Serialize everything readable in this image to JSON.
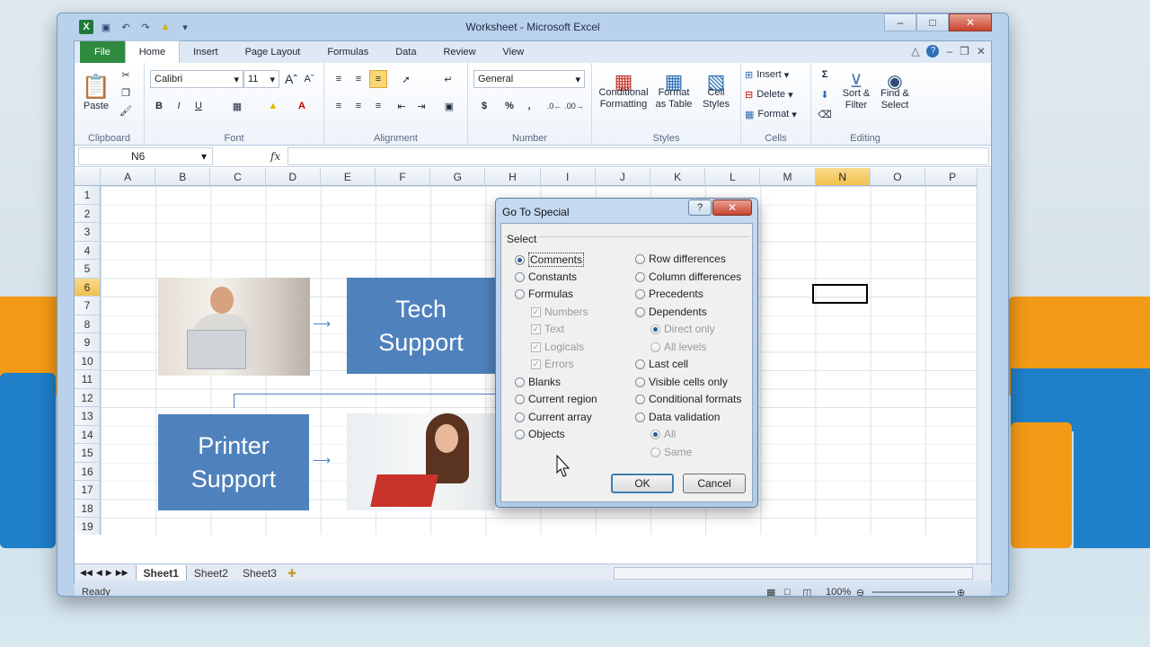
{
  "window": {
    "title": "Worksheet - Microsoft Excel"
  },
  "tabs": [
    "File",
    "Home",
    "Insert",
    "Page Layout",
    "Formulas",
    "Data",
    "Review",
    "View"
  ],
  "ribbon": {
    "clipboard": {
      "label": "Clipboard",
      "paste": "Paste"
    },
    "font": {
      "label": "Font",
      "name": "Calibri",
      "size": "11",
      "bold": "B",
      "italic": "I",
      "underline": "U"
    },
    "alignment": {
      "label": "Alignment"
    },
    "number": {
      "label": "Number",
      "format": "General",
      "currency": "$",
      "percent": "%",
      "comma": ","
    },
    "styles": {
      "label": "Styles",
      "conditional": "Conditional Formatting",
      "format_table": "Format as Table",
      "cell_styles": "Cell Styles"
    },
    "cells": {
      "label": "Cells",
      "insert": "Insert",
      "delete": "Delete",
      "format": "Format"
    },
    "editing": {
      "label": "Editing",
      "sort": "Sort & Filter",
      "find": "Find & Select"
    }
  },
  "formula_bar": {
    "name_box": "N6",
    "fx": "fx"
  },
  "columns": [
    "A",
    "B",
    "C",
    "D",
    "E",
    "F",
    "G",
    "H",
    "I",
    "J",
    "K",
    "L",
    "M",
    "N",
    "O",
    "P"
  ],
  "selected_column": "N",
  "rows": [
    "1",
    "2",
    "3",
    "4",
    "5",
    "6",
    "7",
    "8",
    "9",
    "10",
    "11",
    "12",
    "13",
    "14",
    "15",
    "16",
    "17",
    "18",
    "19"
  ],
  "selected_row": "6",
  "smartart": {
    "box1": "Tech Support",
    "box2": "Printer Support"
  },
  "sheets": [
    "Sheet1",
    "Sheet2",
    "Sheet3"
  ],
  "status": {
    "ready": "Ready",
    "zoom": "100%"
  },
  "dialog": {
    "title": "Go To Special",
    "help": "?",
    "group": "Select",
    "left_options": [
      "Comments",
      "Constants",
      "Formulas",
      "Blanks",
      "Current region",
      "Current array",
      "Objects"
    ],
    "formula_types": [
      "Numbers",
      "Text",
      "Logicals",
      "Errors"
    ],
    "right_options": [
      "Row differences",
      "Column differences",
      "Precedents",
      "Dependents",
      "Last cell",
      "Visible cells only",
      "Conditional formats",
      "Data validation"
    ],
    "dependents_sub": [
      "Direct only",
      "All levels"
    ],
    "validation_sub": [
      "All",
      "Same"
    ],
    "ok": "OK",
    "cancel": "Cancel"
  }
}
